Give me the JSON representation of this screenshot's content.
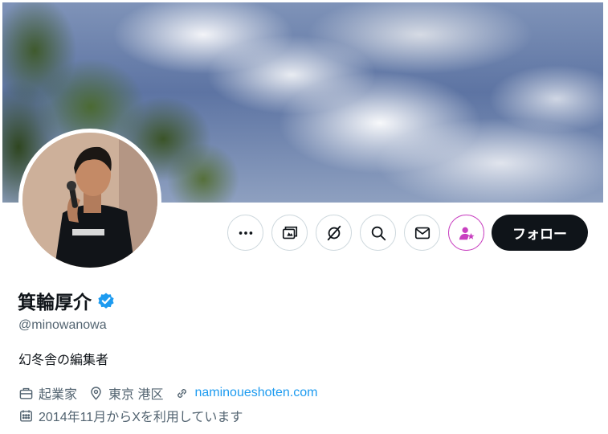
{
  "profile": {
    "display_name": "箕輪厚介",
    "handle": "@minowanowa",
    "bio": "幻冬舎の編集者",
    "verified_icon": "verified-badge-icon",
    "verified_color": "#1d9bf0"
  },
  "actions": {
    "more_icon": "more-icon",
    "creator_icon": "creator-studio-icon",
    "grok_icon": "grok-icon",
    "search_icon": "search-icon",
    "message_icon": "message-icon",
    "subscribe_icon": "subscribe-icon",
    "follow_label": "フォロー"
  },
  "meta": {
    "profession": "起業家",
    "location": "東京 港区",
    "website": "naminoueshoten.com",
    "joined": "2014年11月からXを利用しています"
  },
  "colors": {
    "link": "#1d9bf0",
    "secondary_text": "#536471",
    "subscribe_accent": "#c840c0",
    "follow_bg": "#0f1419"
  }
}
